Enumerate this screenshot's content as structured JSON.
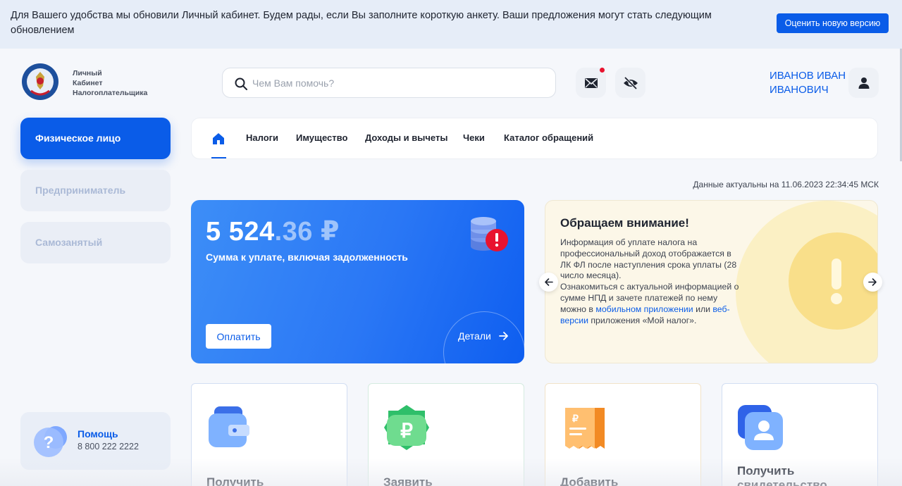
{
  "banner": {
    "text": "Для Вашего удобства мы обновили Личный кабинет. Будем рады, если Вы заполните короткую анкету. Ваши предложения могут стать следующим обновлением",
    "button": "Оценить новую версию"
  },
  "header": {
    "logo_line1": "Личный",
    "logo_line2": "Кабинет",
    "logo_line3": "Налогоплательщика",
    "search_placeholder": "Чем Вам помочь?",
    "user_name": "ИВАНОВ ИВАН ИВАНОВИЧ",
    "mail_icon": "mail-icon",
    "eye_icon": "eye-off-icon",
    "avatar_icon": "user-icon"
  },
  "sidebar": {
    "items": [
      {
        "label": "Физическое лицо",
        "active": true
      },
      {
        "label": "Предприниматель",
        "active": false
      },
      {
        "label": "Самозанятый",
        "active": false
      }
    ],
    "help_title": "Помощь",
    "help_phone": "8 800 222 2222"
  },
  "nav": {
    "home_icon": "home-icon",
    "items": [
      "Налоги",
      "Имущество",
      "Доходы и вычеты",
      "Чеки",
      "Каталог обращений"
    ]
  },
  "status": {
    "actual_date": "Данные актуальны на 11.06.2023 22:34:45 МСК"
  },
  "balance": {
    "amount_int": "5 524",
    "amount_dec": ".36 ₽",
    "subtitle": "Сумма к уплате, включая задолженность",
    "pay_button": "Оплатить",
    "details": "Детали"
  },
  "notice": {
    "title": "Обращаем внимание!",
    "body_1": "Информация об уплате налога на профессиональный доход отображается в ЛК ФЛ после наступления срока уплаты (28 число месяца).",
    "body_2": "Ознакомиться с актуальной информацией о сумме НПД и зачете платежей по нему можно в ",
    "link_1": "мобильном приложении",
    "body_3": " или ",
    "link_2": "веб-версии",
    "body_4": " приложения «Мой налог»."
  },
  "services": [
    {
      "label": "Получить"
    },
    {
      "label": "Заявить"
    },
    {
      "label": "Добавить"
    },
    {
      "label": "Получить свидетельство"
    }
  ],
  "colors": {
    "accent": "#0a5ce8",
    "alert": "#e8132f",
    "notice_bg": "#fcf7e8"
  }
}
